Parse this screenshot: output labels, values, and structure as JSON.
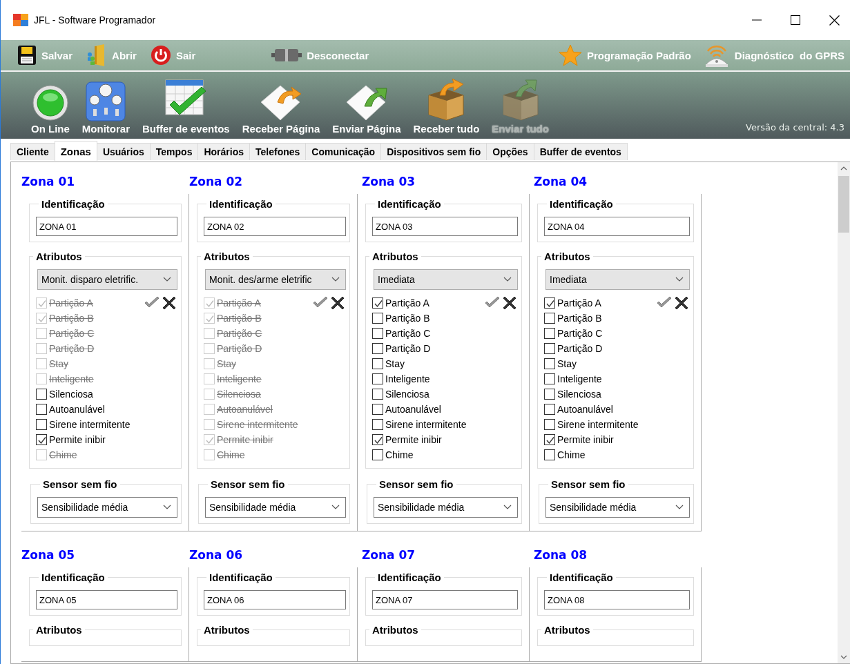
{
  "window": {
    "title": "JFL - Software Programador"
  },
  "toolbar": {
    "items": [
      {
        "label": "Salvar"
      },
      {
        "label": "Abrir"
      },
      {
        "label": "Sair"
      },
      {
        "label": "Desconectar"
      },
      {
        "label": "Programação Padrão"
      },
      {
        "label": "Diagnóstico  do GPRS"
      }
    ]
  },
  "ribbon": {
    "items": [
      {
        "label": "On Line",
        "disabled": false
      },
      {
        "label": "Monitorar",
        "disabled": false
      },
      {
        "label": "Buffer de eventos",
        "disabled": false
      },
      {
        "label": "Receber Página",
        "disabled": false
      },
      {
        "label": "Enviar Página",
        "disabled": false
      },
      {
        "label": "Receber tudo",
        "disabled": false
      },
      {
        "label": "Enviar tudo",
        "disabled": true
      }
    ],
    "version": "Versão da central: 4.3"
  },
  "tabs": [
    {
      "label": "Cliente",
      "selected": false
    },
    {
      "label": "Zonas",
      "selected": true
    },
    {
      "label": "Usuários",
      "selected": false
    },
    {
      "label": "Tempos",
      "selected": false
    },
    {
      "label": "Horários",
      "selected": false
    },
    {
      "label": "Telefones",
      "selected": false
    },
    {
      "label": "Comunicação",
      "selected": false
    },
    {
      "label": "Dispositivos sem fio",
      "selected": false
    },
    {
      "label": "Opções",
      "selected": false
    },
    {
      "label": "Buffer de eventos",
      "selected": false
    }
  ],
  "zones": [
    {
      "title": "Zona 01",
      "identification_label": "Identificação",
      "identification": "ZONA 01",
      "attributes_label": "Atributos",
      "attribute_type": "Monit. disparo eletrific.",
      "options": [
        {
          "label": "Partição A",
          "checked": true,
          "disabled": true
        },
        {
          "label": "Partição B",
          "checked": true,
          "disabled": true
        },
        {
          "label": "Partição C",
          "checked": false,
          "disabled": true
        },
        {
          "label": "Partição D",
          "checked": false,
          "disabled": true
        },
        {
          "label": "Stay",
          "checked": false,
          "disabled": true
        },
        {
          "label": "Inteligente",
          "checked": false,
          "disabled": true
        },
        {
          "label": "Silenciosa",
          "checked": false,
          "disabled": false
        },
        {
          "label": "Autoanulável",
          "checked": false,
          "disabled": false
        },
        {
          "label": "Sirene intermitente",
          "checked": false,
          "disabled": false
        },
        {
          "label": "Permite inibir",
          "checked": true,
          "disabled": false
        },
        {
          "label": "Chime",
          "checked": false,
          "disabled": true
        }
      ],
      "sensor_label": "Sensor sem fio",
      "sensor": "Sensibilidade média"
    },
    {
      "title": "Zona 02",
      "identification_label": "Identificação",
      "identification": "ZONA 02",
      "attributes_label": "Atributos",
      "attribute_type": "Monit. des/arme eletrific",
      "options": [
        {
          "label": "Partição A",
          "checked": true,
          "disabled": true
        },
        {
          "label": "Partição B",
          "checked": true,
          "disabled": true
        },
        {
          "label": "Partição C",
          "checked": false,
          "disabled": true
        },
        {
          "label": "Partição D",
          "checked": false,
          "disabled": true
        },
        {
          "label": "Stay",
          "checked": false,
          "disabled": true
        },
        {
          "label": "Inteligente",
          "checked": false,
          "disabled": true
        },
        {
          "label": "Silenciosa",
          "checked": false,
          "disabled": true
        },
        {
          "label": "Autoanulável",
          "checked": false,
          "disabled": true
        },
        {
          "label": "Sirene intermitente",
          "checked": false,
          "disabled": true
        },
        {
          "label": "Permite inibir",
          "checked": true,
          "disabled": true
        },
        {
          "label": "Chime",
          "checked": false,
          "disabled": true
        }
      ],
      "sensor_label": "Sensor sem fio",
      "sensor": "Sensibilidade média"
    },
    {
      "title": "Zona 03",
      "identification_label": "Identificação",
      "identification": "ZONA 03",
      "attributes_label": "Atributos",
      "attribute_type": "Imediata",
      "options": [
        {
          "label": "Partição A",
          "checked": true,
          "disabled": false
        },
        {
          "label": "Partição B",
          "checked": false,
          "disabled": false
        },
        {
          "label": "Partição C",
          "checked": false,
          "disabled": false
        },
        {
          "label": "Partição D",
          "checked": false,
          "disabled": false
        },
        {
          "label": "Stay",
          "checked": false,
          "disabled": false
        },
        {
          "label": "Inteligente",
          "checked": false,
          "disabled": false
        },
        {
          "label": "Silenciosa",
          "checked": false,
          "disabled": false
        },
        {
          "label": "Autoanulável",
          "checked": false,
          "disabled": false
        },
        {
          "label": "Sirene intermitente",
          "checked": false,
          "disabled": false
        },
        {
          "label": "Permite inibir",
          "checked": true,
          "disabled": false
        },
        {
          "label": "Chime",
          "checked": false,
          "disabled": false
        }
      ],
      "sensor_label": "Sensor sem fio",
      "sensor": "Sensibilidade média"
    },
    {
      "title": "Zona 04",
      "identification_label": "Identificação",
      "identification": "ZONA 04",
      "attributes_label": "Atributos",
      "attribute_type": "Imediata",
      "options": [
        {
          "label": "Partição A",
          "checked": true,
          "disabled": false
        },
        {
          "label": "Partição B",
          "checked": false,
          "disabled": false
        },
        {
          "label": "Partição C",
          "checked": false,
          "disabled": false
        },
        {
          "label": "Partição D",
          "checked": false,
          "disabled": false
        },
        {
          "label": "Stay",
          "checked": false,
          "disabled": false
        },
        {
          "label": "Inteligente",
          "checked": false,
          "disabled": false
        },
        {
          "label": "Silenciosa",
          "checked": false,
          "disabled": false
        },
        {
          "label": "Autoanulável",
          "checked": false,
          "disabled": false
        },
        {
          "label": "Sirene intermitente",
          "checked": false,
          "disabled": false
        },
        {
          "label": "Permite inibir",
          "checked": true,
          "disabled": false
        },
        {
          "label": "Chime",
          "checked": false,
          "disabled": false
        }
      ],
      "sensor_label": "Sensor sem fio",
      "sensor": "Sensibilidade média"
    },
    {
      "title": "Zona 05",
      "identification_label": "Identificação",
      "identification": "ZONA 05",
      "attributes_label": "Atributos"
    },
    {
      "title": "Zona 06",
      "identification_label": "Identificação",
      "identification": "ZONA 06",
      "attributes_label": "Atributos"
    },
    {
      "title": "Zona 07",
      "identification_label": "Identificação",
      "identification": "ZONA 07",
      "attributes_label": "Atributos"
    },
    {
      "title": "Zona 08",
      "identification_label": "Identificação",
      "identification": "ZONA 08",
      "attributes_label": "Atributos"
    }
  ]
}
